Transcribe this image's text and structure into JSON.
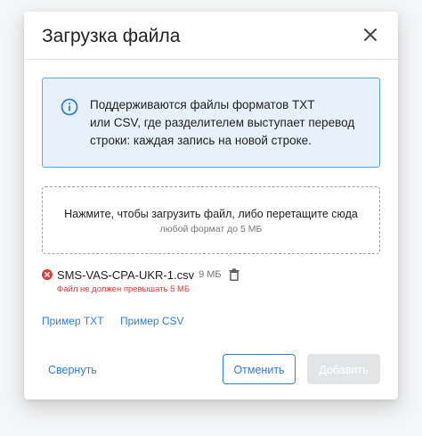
{
  "dialog": {
    "title": "Загрузка файла",
    "close_icon": "close-icon"
  },
  "info": {
    "icon": "info-icon",
    "line1": "Поддерживаются файлы форматов TXT",
    "line2": "или CSV, где разделителем выступает перевод",
    "line3": "строки: каждая запись на новой строке."
  },
  "dropzone": {
    "main_text": "Нажмите, чтобы загрузить файл, либо перетащите сюда",
    "sub_text": "любой формат до 5 МБ"
  },
  "file": {
    "status_icon": "error-icon",
    "name": "SMS-VAS-CPA-UKR-1.csv",
    "size": "9 МБ",
    "delete_icon": "trash-icon",
    "error": "Файл не должен превышать 5 МБ"
  },
  "links": {
    "txt_example": "Пример TXT",
    "csv_example": "Пример CSV"
  },
  "footer": {
    "collapse": "Свернуть",
    "cancel": "Отменить",
    "add": "Добавить"
  },
  "colors": {
    "accent": "#2f7fd8",
    "info_bg": "#e6f1fb",
    "info_border": "#5aa6e6",
    "error": "#e53935",
    "disabled": "#e2e4e6"
  }
}
